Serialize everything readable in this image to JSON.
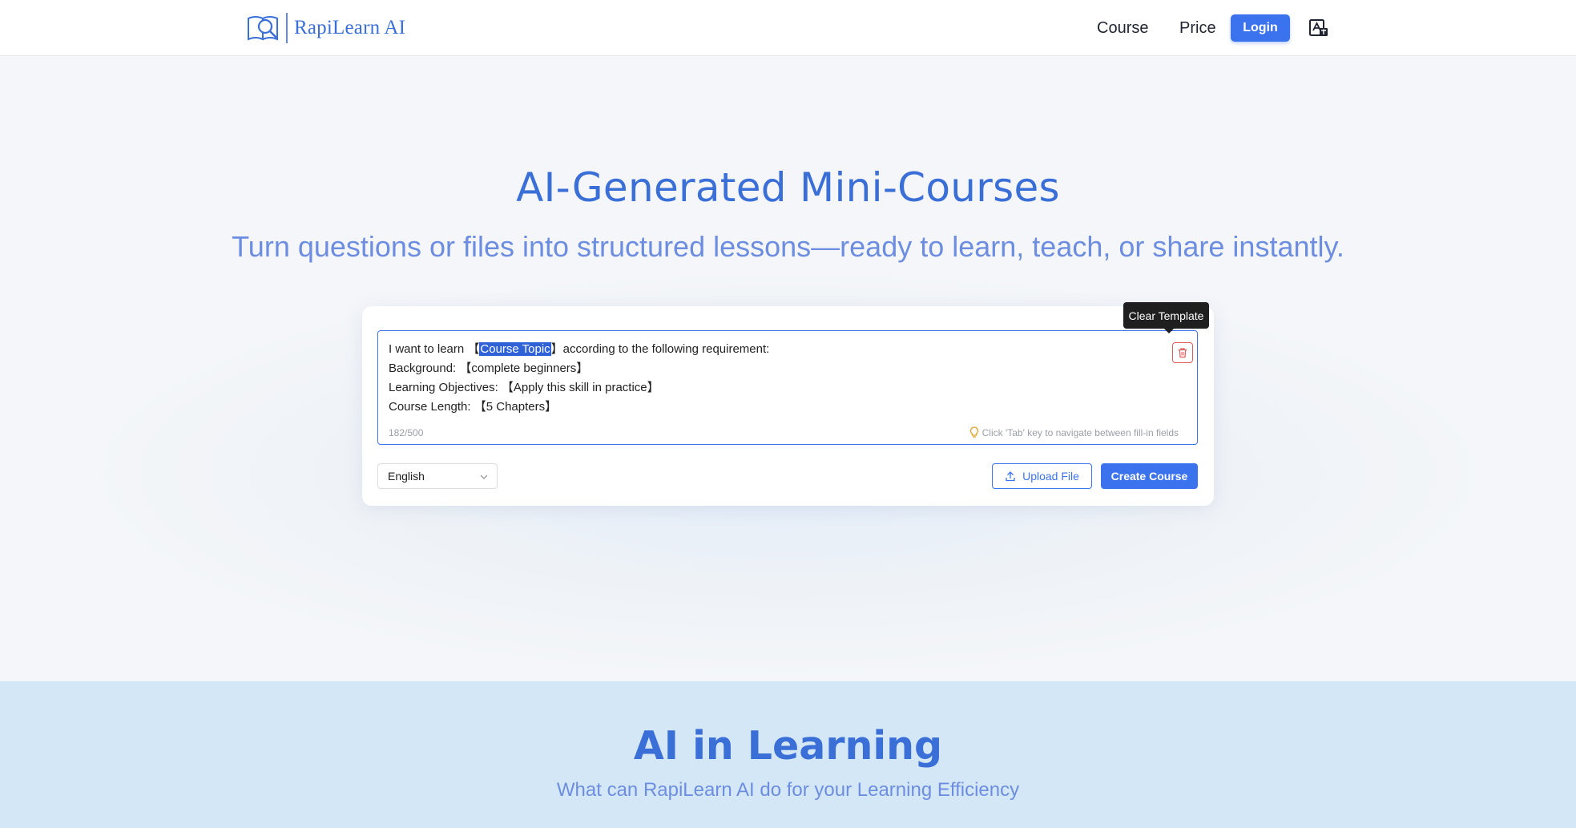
{
  "header": {
    "brand": "RapiLearn AI",
    "nav": {
      "course": "Course",
      "price": "Price"
    },
    "login_label": "Login"
  },
  "hero": {
    "title": "AI-Generated Mini-Courses",
    "subtitle": "Turn questions or files into structured lessons—ready to learn, teach, or share instantly."
  },
  "prompt": {
    "line1_pre": "I want to learn 【",
    "line1_highlight": "Course Topic",
    "line1_post": "】according to the following requirement:",
    "line2": "Background: 【complete beginners】",
    "line3": "Learning Objectives: 【Apply this skill in practice】",
    "line4": "Course Length: 【5 Chapters】",
    "char_count": "182/500",
    "tab_hint": "Click 'Tab' key to navigate between fill-in fields",
    "clear_tooltip": "Clear Template"
  },
  "controls": {
    "language": "English",
    "upload_label": "Upload File",
    "create_label": "Create Course"
  },
  "section2": {
    "title": "AI in Learning",
    "subtitle": "What can RapiLearn AI do for your Learning Efficiency"
  },
  "colors": {
    "accent": "#3b73ee",
    "brand": "#3b6fd8",
    "danger": "#e05a5a",
    "section2_bg": "#d4e7f6"
  },
  "icons": [
    "book-logo-icon",
    "translate-icon",
    "trash-icon",
    "lightbulb-icon",
    "chevron-down-icon",
    "upload-icon"
  ]
}
